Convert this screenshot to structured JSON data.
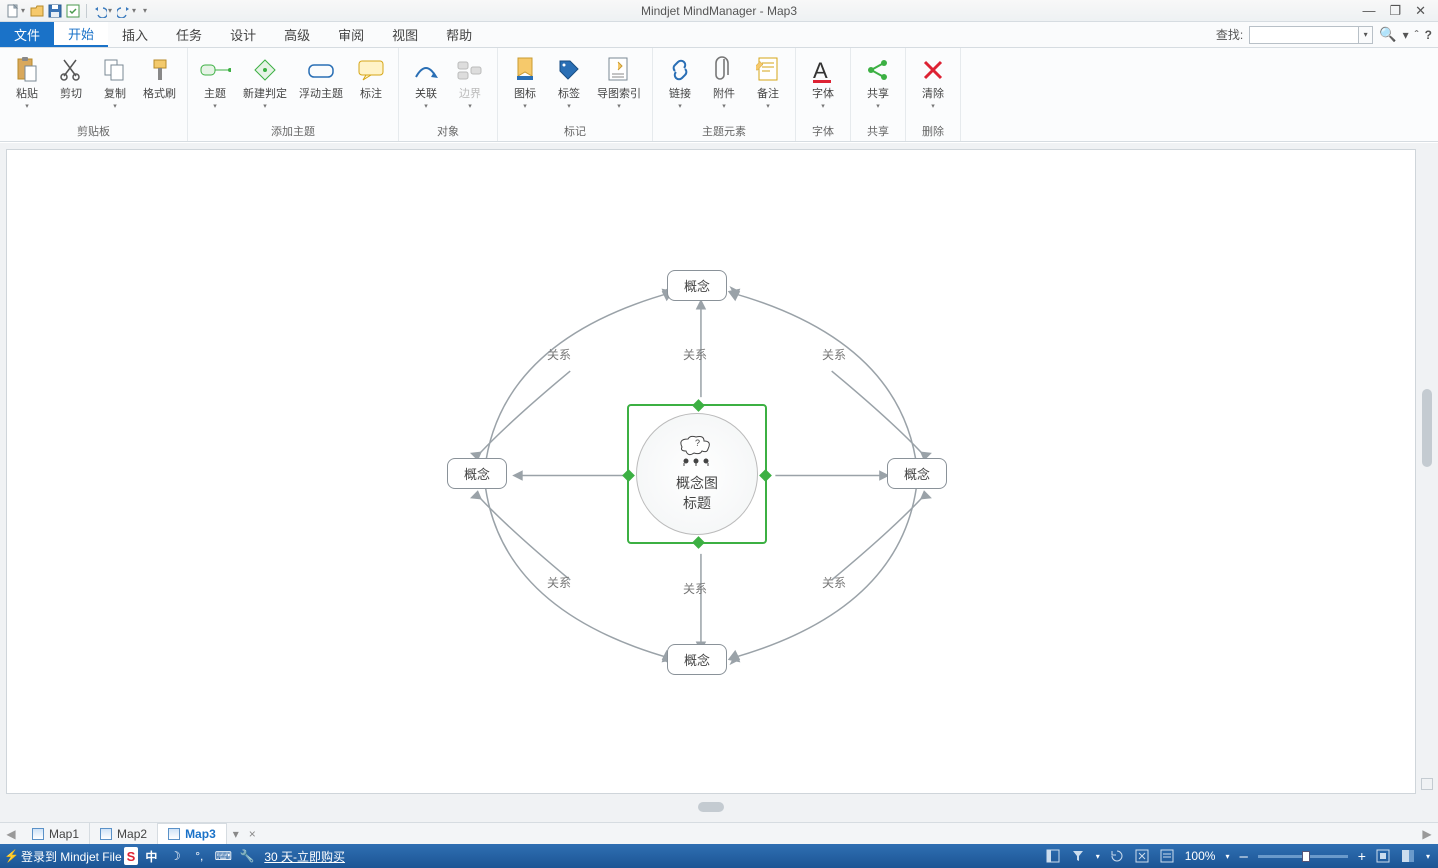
{
  "app": {
    "title": "Mindjet MindManager - Map3"
  },
  "qat": {
    "items": [
      "new",
      "open",
      "save",
      "wizard",
      "undo",
      "redo",
      "customize"
    ]
  },
  "window": {
    "min": "—",
    "max": "❐",
    "close": "✕"
  },
  "tabs": {
    "file": "文件",
    "start": "开始",
    "insert": "插入",
    "task": "任务",
    "design": "设计",
    "advanced": "高级",
    "review": "审阅",
    "view": "视图",
    "help": "帮助"
  },
  "menuRight": {
    "searchLabel": "查找:"
  },
  "ribbon": {
    "clipboard": {
      "paste": "粘贴",
      "cut": "剪切",
      "copy": "复制",
      "format": "格式刷",
      "group": "剪贴板"
    },
    "addTopic": {
      "topic": "主题",
      "newJudge": "新建判定",
      "float": "浮动主题",
      "note": "标注",
      "group": "添加主题"
    },
    "object": {
      "relate": "关联",
      "boundary": "边界",
      "group": "对象"
    },
    "mark": {
      "icon": "图标",
      "tag": "标签",
      "index": "导图索引",
      "group": "标记"
    },
    "element": {
      "link": "链接",
      "attach": "附件",
      "memo": "备注",
      "group": "主题元素"
    },
    "font": {
      "font": "字体",
      "group": "字体"
    },
    "share": {
      "share": "共享",
      "group": "共享"
    },
    "clear": {
      "clear": "清除",
      "group": "删除"
    }
  },
  "map": {
    "central1": "概念图",
    "central2": "标题",
    "top": "概念",
    "left": "概念",
    "right": "概念",
    "bottom": "概念",
    "rel": "关系"
  },
  "doctabs": {
    "map1": "Map1",
    "map2": "Map2",
    "map3": "Map3",
    "close": "×"
  },
  "status": {
    "login": "登录到 Mindjet File",
    "zh": "中",
    "trial": "30 天-立即购买",
    "zoom": "100%",
    "plus": "+",
    "minus": "–"
  }
}
